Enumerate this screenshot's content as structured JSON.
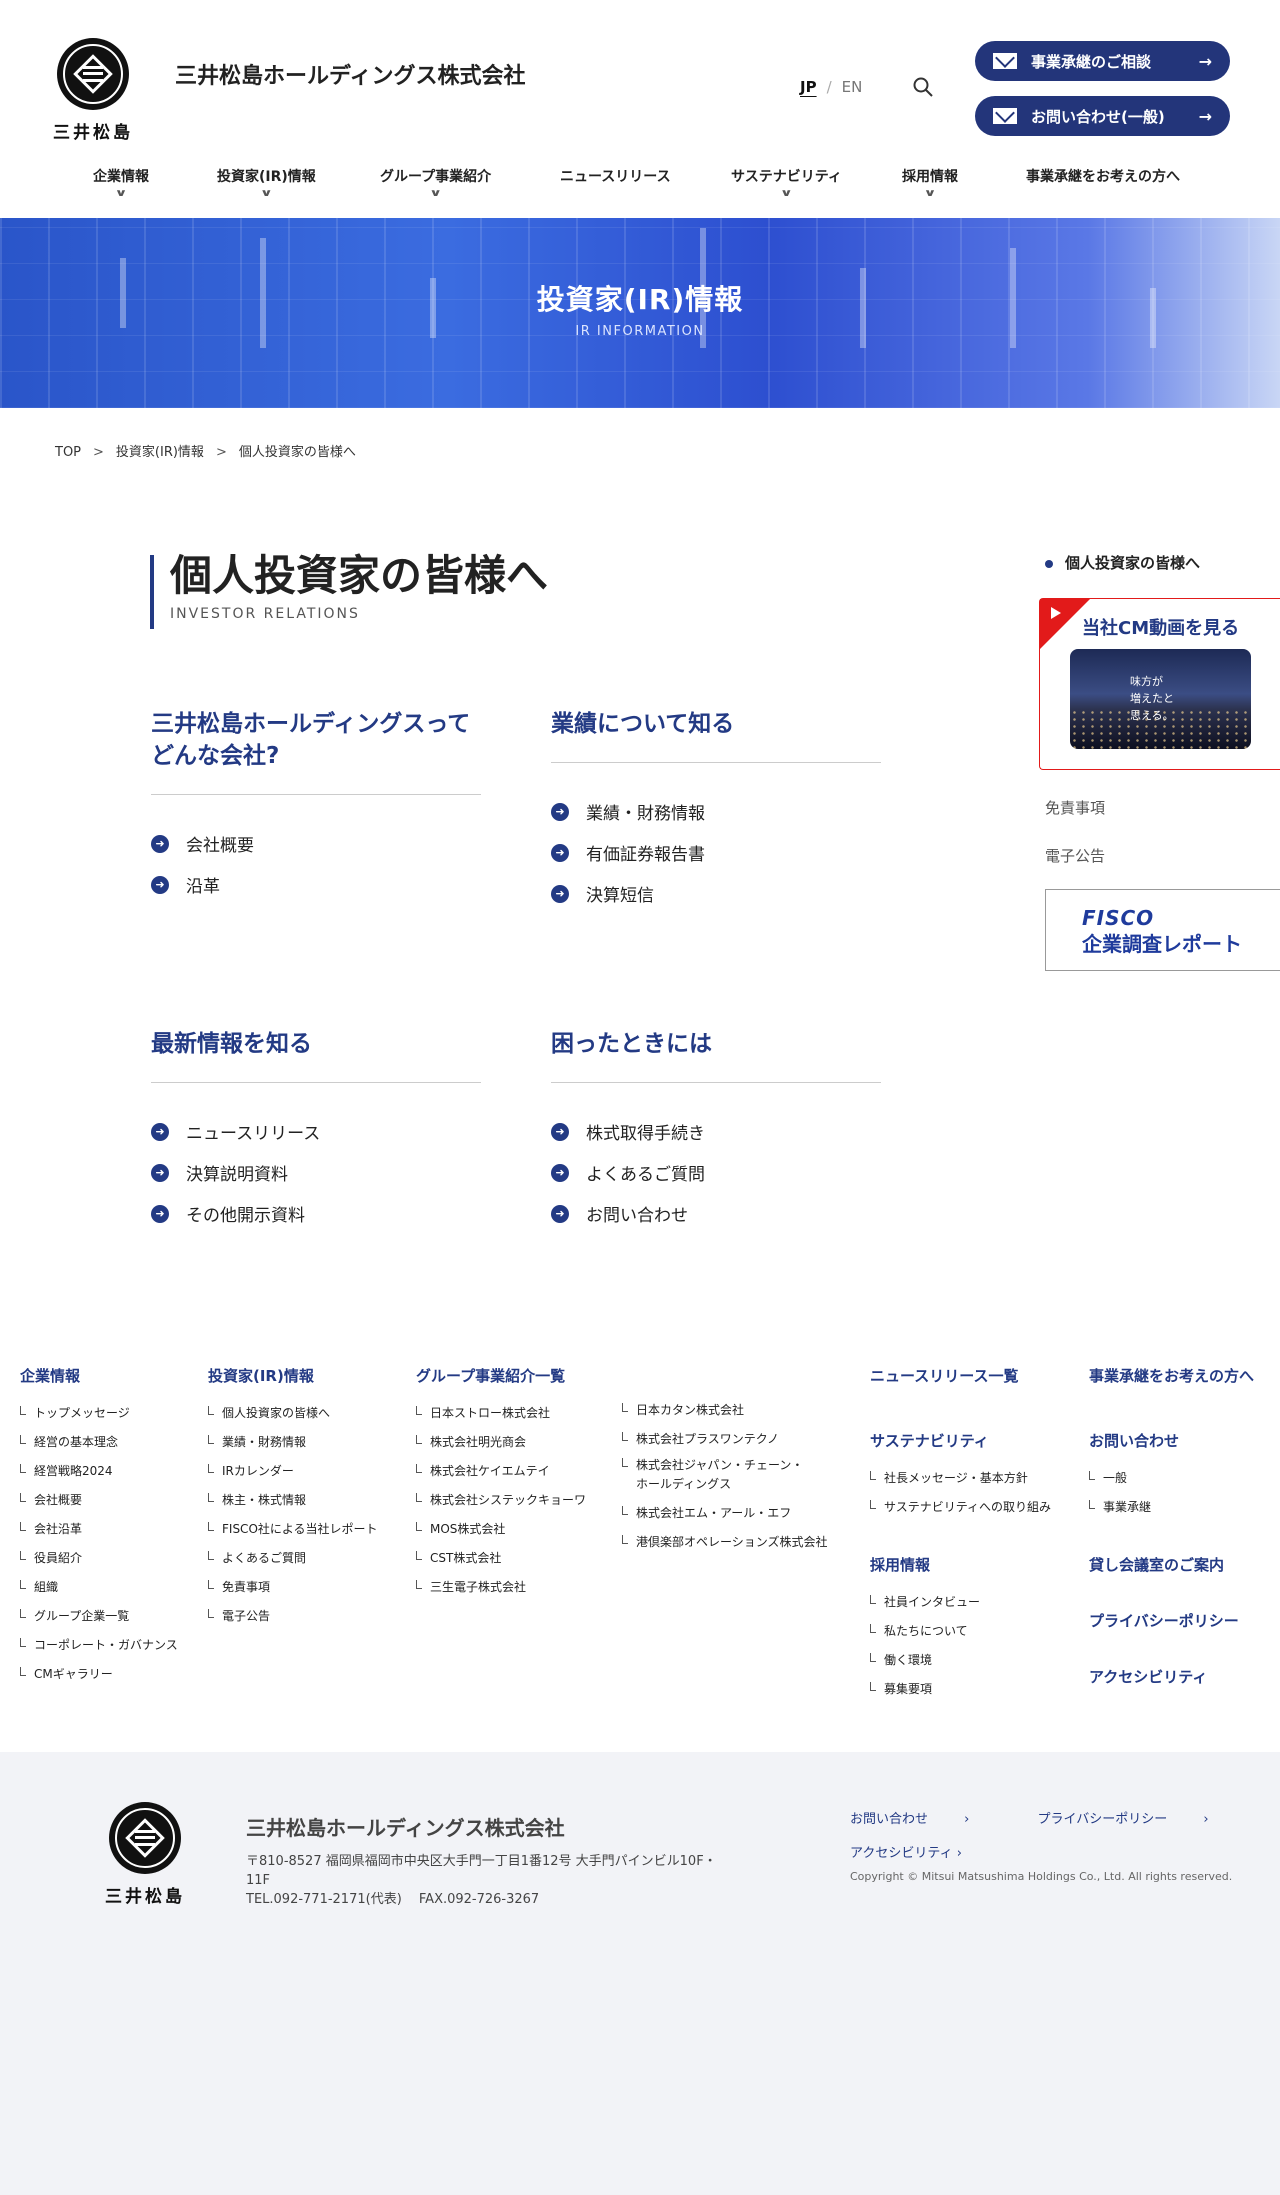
{
  "header": {
    "logo_text": "三井松島",
    "company_name": "三井松島ホールディングス株式会社",
    "lang_jp": "JP",
    "lang_sep": "/",
    "lang_en": "EN",
    "cta_succession": "事業承継のご相談",
    "cta_contact": "お問い合わせ(一般)",
    "nav": [
      {
        "label": "企業情報",
        "has_sub": true
      },
      {
        "label": "投資家(IR)情報",
        "has_sub": true
      },
      {
        "label": "グループ事業紹介",
        "has_sub": true
      },
      {
        "label": "ニュースリリース",
        "has_sub": false
      },
      {
        "label": "サステナビリティ",
        "has_sub": true
      },
      {
        "label": "採用情報",
        "has_sub": true
      },
      {
        "label": "事業承継をお考えの方へ",
        "has_sub": false
      }
    ]
  },
  "hero": {
    "title": "投資家(IR)情報",
    "subtitle": "IR INFORMATION"
  },
  "breadcrumb": [
    "TOP",
    "投資家(IR)情報",
    "個人投資家の皆様へ"
  ],
  "page": {
    "title": "個人投資家の皆様へ",
    "subtitle": "INVESTOR RELATIONS"
  },
  "sections": [
    {
      "title": "三井松島ホールディングスってどんな会社?",
      "title_l1": "三井松島ホールディングスって",
      "title_l2": "どんな会社?",
      "links": [
        "会社概要",
        "沿革"
      ]
    },
    {
      "title": "業績について知る",
      "links": [
        "業績・財務情報",
        "有価証券報告書",
        "決算短信"
      ]
    },
    {
      "title": "最新情報を知る",
      "links": [
        "ニュースリリース",
        "決算説明資料",
        "その他開示資料"
      ]
    },
    {
      "title": "困ったときには",
      "links": [
        "株式取得手続き",
        "よくあるご質問",
        "お問い合わせ"
      ]
    }
  ],
  "side": {
    "current": "個人投資家の皆様へ",
    "cm_title": "当社CM動画を見る",
    "cm_caption_l1": "味方が",
    "cm_caption_l2": "増えたと",
    "cm_caption_l3": "思える。",
    "disclaimer": "免責事項",
    "e_notice": "電子公告",
    "fisco_l1": "FISCO",
    "fisco_l2": "企業調査レポート"
  },
  "footer_nav": {
    "company": {
      "title": "企業情報",
      "items": [
        "トップメッセージ",
        "経営の基本理念",
        "経営戦略2024",
        "会社概要",
        "会社沿革",
        "役員紹介",
        "組織",
        "グループ企業一覧",
        "コーポレート・ガバナンス",
        "CMギャラリー"
      ]
    },
    "ir": {
      "title": "投資家(IR)情報",
      "items": [
        "個人投資家の皆様へ",
        "業績・財務情報",
        "IRカレンダー",
        "株主・株式情報",
        "FISCO社による当社レポート",
        "よくあるご質問",
        "免責事項",
        "電子公告"
      ]
    },
    "group": {
      "title": "グループ事業紹介一覧",
      "items_a": [
        "日本ストロー株式会社",
        "株式会社明光商会",
        "株式会社ケイエムテイ",
        "株式会社システックキョーワ",
        "MOS株式会社",
        "CST株式会社",
        "三生電子株式会社"
      ],
      "items_b_1": "日本カタン株式会社",
      "items_b_2": "株式会社プラスワンテクノ",
      "items_b_3_l1": "株式会社ジャパン・チェーン・",
      "items_b_3_l2": "ホールディングス",
      "items_b_4": "株式会社エム・アール・エフ",
      "items_b_5": "港倶楽部オペレーションズ株式会社"
    },
    "news": "ニュースリリース一覧",
    "sustainability": {
      "title": "サステナビリティ",
      "items": [
        "社長メッセージ・基本方針",
        "サステナビリティへの取り組み"
      ]
    },
    "recruit": {
      "title": "採用情報",
      "items": [
        "社員インタビュー",
        "私たちについて",
        "働く環境",
        "募集要項"
      ]
    },
    "succession": "事業承継をお考えの方へ",
    "contact": {
      "title": "お問い合わせ",
      "items": [
        "一般",
        "事業承継"
      ]
    },
    "rental": "貸し会議室のご案内",
    "privacy": "プライバシーポリシー",
    "accessibility": "アクセシビリティ"
  },
  "footer": {
    "logo_text": "三井松島",
    "company": "三井松島ホールディングス株式会社",
    "address_l1": "〒810-8527 福岡県福岡市中央区大手門一丁目1番12号 大手門パインビル10F・",
    "address_l2": "11F",
    "tel": "TEL.092-771-2171(代表)　 FAX.092-726-3267",
    "link_contact": "お問い合わせ",
    "link_privacy": "プライバシーポリシー",
    "link_accessibility": "アクセシビリティ",
    "copyright": "Copyright © Mitsui Matsushima Holdings Co., Ltd. All rights reserved."
  }
}
